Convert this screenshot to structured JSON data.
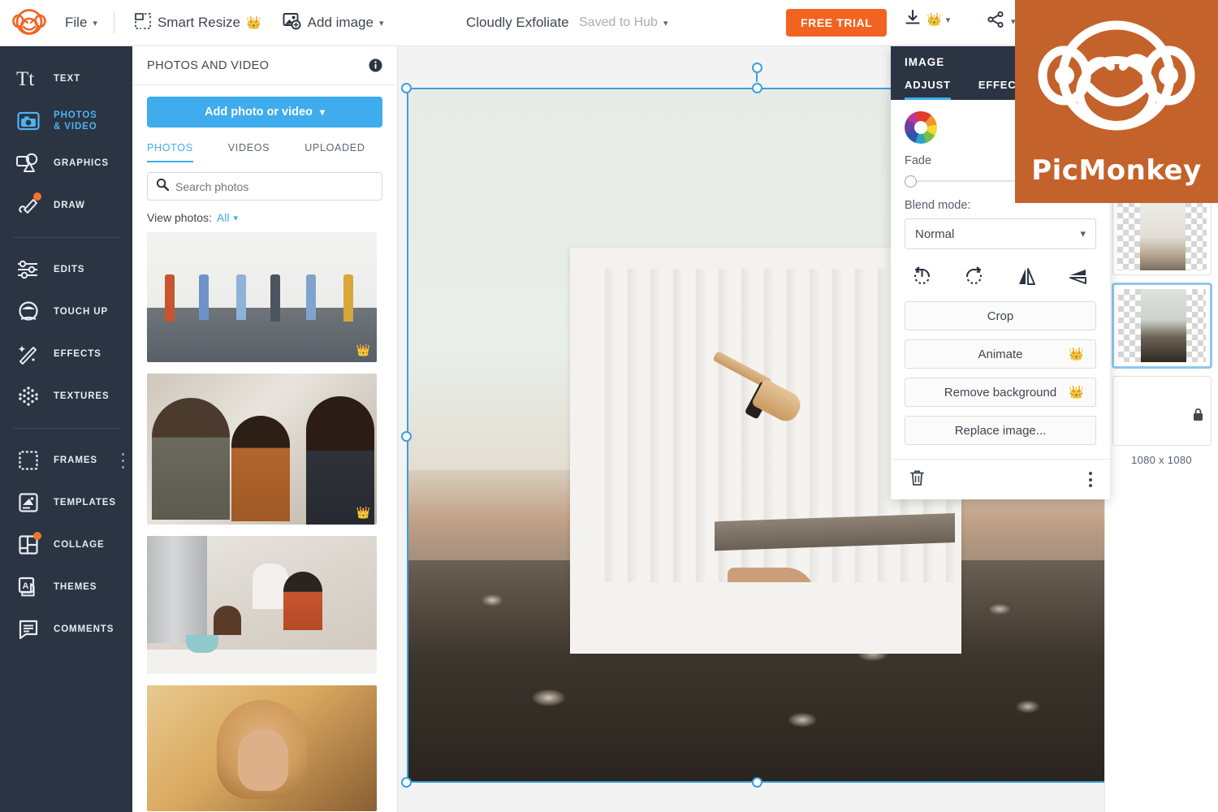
{
  "topbar": {
    "logo_icon": "picmonkey-monkey-logo",
    "file_label": "File",
    "smart_resize_label": "Smart Resize",
    "smart_resize_icon": "smart-resize-icon",
    "smart_resize_crown": "👑",
    "add_image_label": "Add image",
    "add_image_icon": "add-image-icon",
    "doc_title": "Cloudly Exfoliate",
    "save_status": "Saved to Hub",
    "free_trial_label": "FREE TRIAL",
    "download_icon": "download-icon",
    "download_crown": "👑",
    "share_icon": "share-icon",
    "caret": "⌄"
  },
  "sidebar": {
    "items": [
      {
        "label": "TEXT",
        "icon": "text-tt-icon",
        "active": false,
        "badge": false
      },
      {
        "label": "PHOTOS\n& VIDEO",
        "icon": "photos-video-icon",
        "active": true,
        "badge": false
      },
      {
        "label": "GRAPHICS",
        "icon": "graphics-icon",
        "active": false,
        "badge": false
      },
      {
        "label": "DRAW",
        "icon": "draw-pencil-icon",
        "active": false,
        "badge": true
      },
      {
        "label": "EDITS",
        "icon": "sliders-icon",
        "active": false,
        "badge": false
      },
      {
        "label": "TOUCH UP",
        "icon": "touch-up-face-icon",
        "active": false,
        "badge": false
      },
      {
        "label": "EFFECTS",
        "icon": "magic-wand-icon",
        "active": false,
        "badge": false
      },
      {
        "label": "TEXTURES",
        "icon": "textures-grid-icon",
        "active": false,
        "badge": false
      },
      {
        "label": "FRAMES",
        "icon": "frame-icon",
        "active": false,
        "badge": false
      },
      {
        "label": "TEMPLATES",
        "icon": "templates-icon",
        "active": false,
        "badge": false
      },
      {
        "label": "COLLAGE",
        "icon": "collage-icon",
        "active": false,
        "badge": true
      },
      {
        "label": "THEMES",
        "icon": "themes-icon",
        "active": false,
        "badge": false
      },
      {
        "label": "COMMENTS",
        "icon": "comments-bubble-icon",
        "active": false,
        "badge": false
      }
    ]
  },
  "photos_panel": {
    "title": "PHOTOS AND VIDEO",
    "info_icon": "info-circle-icon",
    "add_button_label": "Add photo or video",
    "tabs": [
      {
        "label": "PHOTOS",
        "active": true
      },
      {
        "label": "VIDEOS",
        "active": false
      },
      {
        "label": "UPLOADED",
        "active": false
      }
    ],
    "search_placeholder": "Search photos",
    "search_value": "",
    "search_icon": "search-magnifier-icon",
    "view_label": "View photos:",
    "view_value": "All",
    "thumbnails": [
      {
        "alt": "people-queuing-social-distance",
        "premium": true
      },
      {
        "alt": "colleagues-meeting-office",
        "premium": true
      },
      {
        "alt": "family-cooking-kitchen",
        "premium": false
      },
      {
        "alt": "smiling-woman-curly-hair",
        "premium": false
      }
    ],
    "crown": "👑"
  },
  "canvas": {
    "artboard_alt": "framed-photo-of-leg-with-dry-brush-over-lake-rocks",
    "selected": true,
    "rotate_handle_icon": "rotate-handle-icon"
  },
  "image_tool": {
    "title": "IMAGE",
    "tabs": [
      {
        "label": "ADJUST",
        "active": true
      },
      {
        "label": "EFFECTS",
        "active": false
      }
    ],
    "color_wheel_icon": "color-wheel-icon",
    "fade_label": "Fade",
    "fade_value": 0,
    "blend_mode_label": "Blend mode:",
    "blend_mode_value": "Normal",
    "transform_icons": [
      "rotate-left-icon",
      "rotate-right-icon",
      "flip-horizontal-icon",
      "flip-vertical-icon"
    ],
    "actions": [
      {
        "label": "Crop",
        "premium": false
      },
      {
        "label": "Animate",
        "premium": true
      },
      {
        "label": "Remove background",
        "premium": true
      },
      {
        "label": "Replace image...",
        "premium": false
      }
    ],
    "delete_icon": "trash-can-icon",
    "more_icon": "kebab-menu-icon",
    "crown": "👑"
  },
  "layers_panel": {
    "layers": [
      {
        "alt": "leg-on-stool-cutout",
        "selected": false
      },
      {
        "alt": "misty-field-photo",
        "selected": true
      },
      {
        "alt": "blank-canvas-layer",
        "selected": false,
        "locked": true
      }
    ],
    "canvas_size": "1080 x 1080",
    "lock_icon": "lock-closed-icon"
  },
  "brand_overlay": {
    "logo_icon": "picmonkey-monkey-logo",
    "name": "PicMonkey",
    "color": "#c4622c"
  },
  "colors": {
    "accent_blue": "#3eaced",
    "orange": "#f26322",
    "dark_navy": "#2b3443",
    "selection_blue": "#3c9fe0"
  }
}
